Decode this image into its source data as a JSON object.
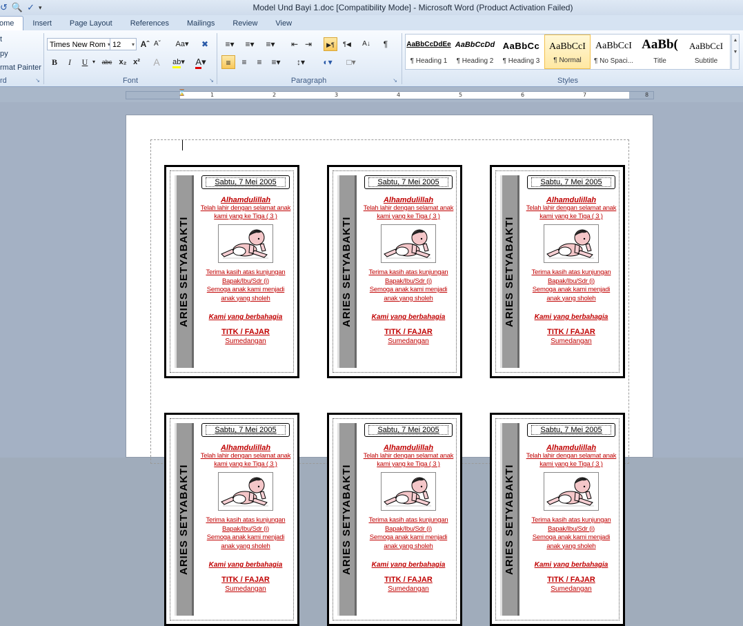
{
  "window": {
    "title": "Model Und Bayi 1.doc [Compatibility Mode]  -  Microsoft Word (Product Activation Failed)"
  },
  "quick_access": [
    "undo-icon",
    "print-preview-icon",
    "spelling-icon",
    "customize-arrow"
  ],
  "tabs": [
    {
      "label": "ome",
      "active": true
    },
    {
      "label": "Insert"
    },
    {
      "label": "Page Layout"
    },
    {
      "label": "References"
    },
    {
      "label": "Mailings"
    },
    {
      "label": "Review"
    },
    {
      "label": "View"
    }
  ],
  "clipboard": {
    "items": [
      "t",
      "py",
      "rmat Painter"
    ],
    "label": "rd"
  },
  "font": {
    "name": "Times New Rom",
    "size": "12",
    "label": "Font"
  },
  "paragraph": {
    "label": "Paragraph"
  },
  "styles": {
    "label": "Styles",
    "tiles": [
      {
        "preview": "AaBbCcDdEe",
        "name": "¶ Heading 1"
      },
      {
        "preview": "AaBbCcDd",
        "name": "¶ Heading 2"
      },
      {
        "preview": "AaBbCc",
        "name": "¶ Heading 3"
      },
      {
        "preview": "AaBbCcI",
        "name": "¶ Normal",
        "selected": true
      },
      {
        "preview": "AaBbCcI",
        "name": "¶ No Spaci..."
      },
      {
        "preview": "AaBb(",
        "name": "Title"
      },
      {
        "preview": "AaBbCcI",
        "name": "Subtitle"
      }
    ]
  },
  "ruler": {
    "numbers": [
      "1",
      "2",
      "3",
      "4",
      "5",
      "6",
      "7",
      "8"
    ]
  },
  "card": {
    "side_text": "ARIES  SETYABAKTI",
    "date": "Sabtu, 7 Mei 2005",
    "greeting": "Alhamdulillah",
    "born_line1": "Telah lahir dengan selamat anak",
    "born_line2": "kami yang ke Tiga ( 3 )",
    "thanks_line1": "Terima kasih atas kunjungan",
    "thanks_line2": "Bapak/Ibu/Sdr (i)",
    "thanks_line3": "Semoga anak kami menjadi",
    "thanks_line4": "anak yang sholeh",
    "happy": "Kami yang berbahagia",
    "names": "TITK / FAJAR",
    "place": "Sumedangan"
  },
  "colors": {
    "card_text": "#c00000",
    "ribbon_bg": "#e4edf8",
    "selected_style": "#ffe8a2"
  }
}
